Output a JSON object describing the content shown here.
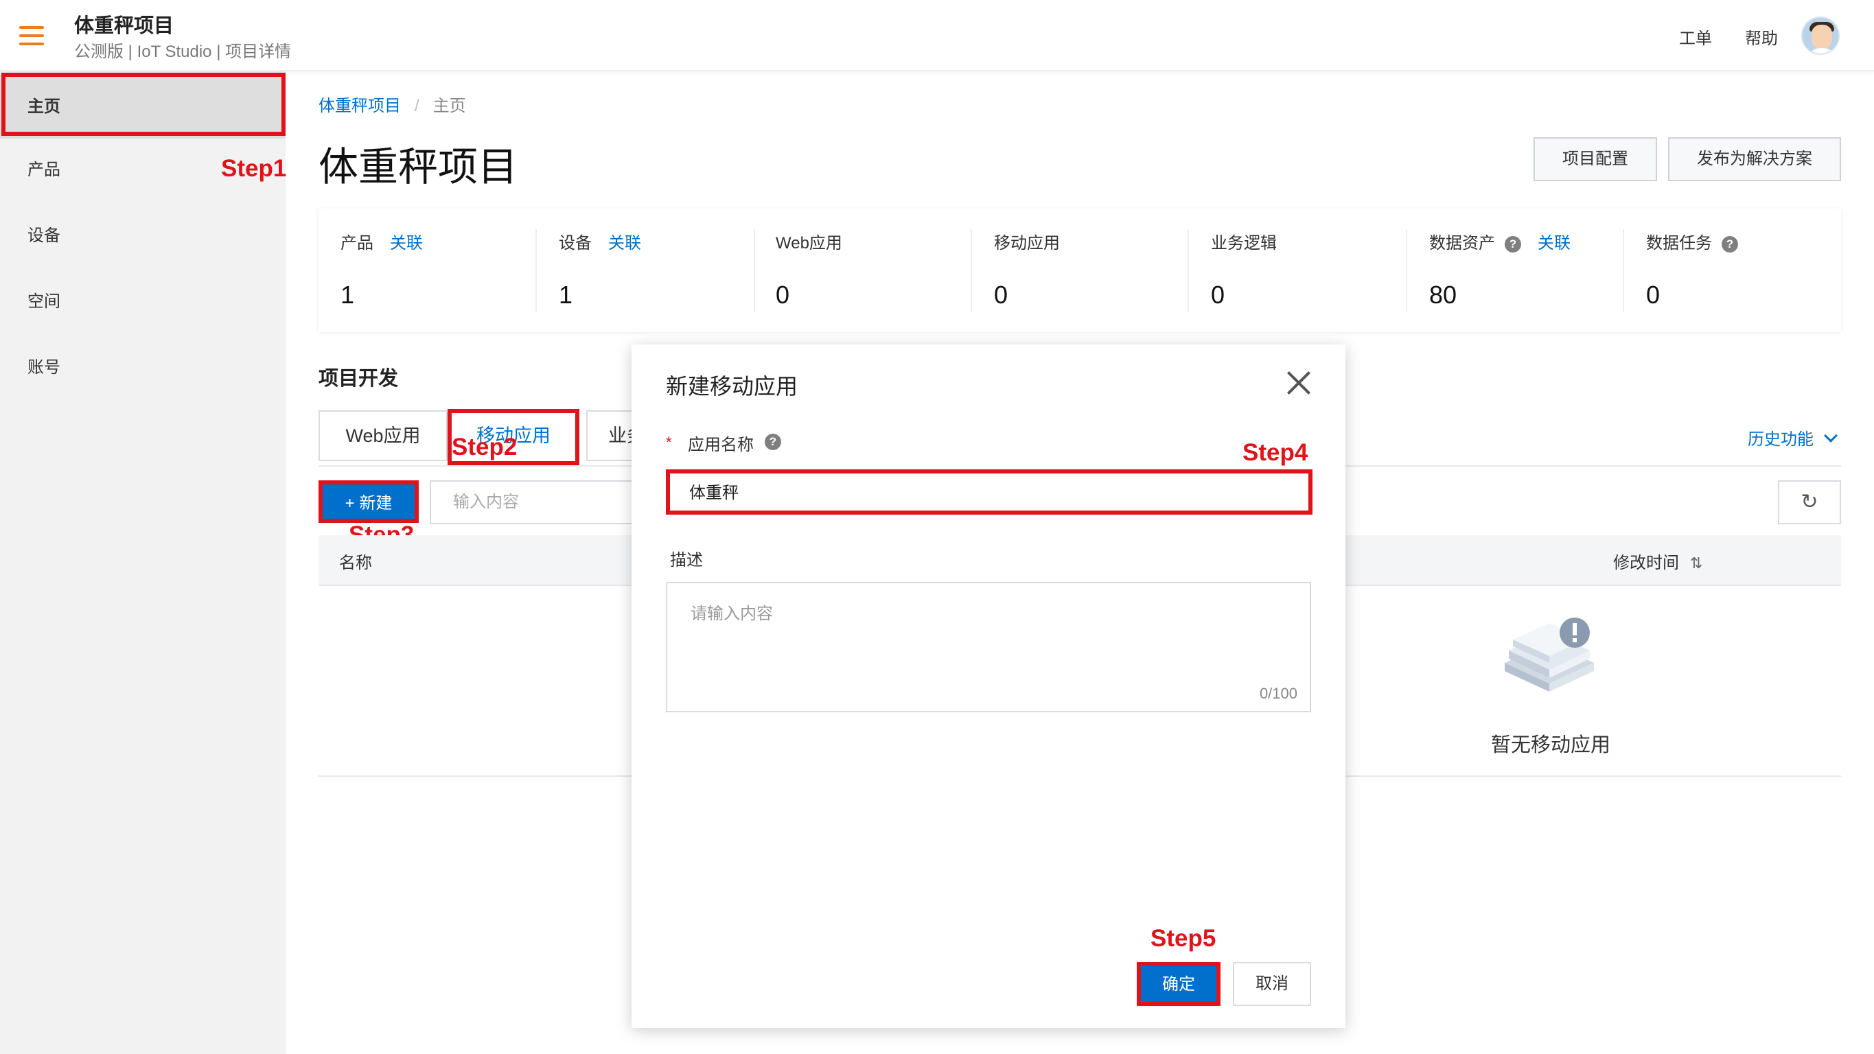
{
  "header": {
    "menu_icon": "hamburger-icon",
    "title": "体重秤项目",
    "subtitle": "公测版 | IoT Studio | 项目详情",
    "links": [
      "工单",
      "帮助"
    ],
    "avatar": "user-avatar"
  },
  "sidebar": {
    "items": [
      {
        "label": "主页",
        "active": true
      },
      {
        "label": "产品"
      },
      {
        "label": "设备"
      },
      {
        "label": "空间"
      },
      {
        "label": "账号"
      }
    ]
  },
  "breadcrumb": {
    "root": "体重秤项目",
    "separator": "/",
    "current": "主页"
  },
  "page": {
    "title": "体重秤项目",
    "buttons": {
      "config": "项目配置",
      "publish": "发布为解决方案"
    }
  },
  "stats": [
    {
      "label": "产品",
      "link": "关联",
      "value": "1"
    },
    {
      "label": "设备",
      "link": "关联",
      "value": "1"
    },
    {
      "label": "Web应用",
      "value": "0"
    },
    {
      "label": "移动应用",
      "value": "0"
    },
    {
      "label": "业务逻辑",
      "value": "0"
    },
    {
      "label": "数据资产",
      "help": "?",
      "link": "关联",
      "value": "80"
    },
    {
      "label": "数据任务",
      "help": "?",
      "value": "0"
    }
  ],
  "dev": {
    "title": "项目开发",
    "tabs": [
      "Web应用",
      "移动应用",
      "业务"
    ],
    "history": "历史功能",
    "new_button": "+ 新建",
    "search_placeholder": "输入内容",
    "refresh_icon": "refresh-icon",
    "columns": {
      "name": "名称",
      "modified": "修改时间"
    },
    "sort_glyph": "⇅",
    "empty_text": "暂无移动应用"
  },
  "modal": {
    "title": "新建移动应用",
    "required_mark": "*",
    "name_label": "应用名称",
    "help": "?",
    "name_value": "体重秤",
    "desc_label": "描述",
    "desc_placeholder": "请输入内容",
    "desc_count": "0/100",
    "ok": "确定",
    "cancel": "取消"
  },
  "annotations": {
    "color": "#e0131b",
    "steps": [
      "Step1",
      "Step2",
      "Step3",
      "Step4",
      "Step5"
    ]
  },
  "colors": {
    "accent": "#0070cc",
    "brand": "#f07b1c",
    "annotation": "#e0131b"
  }
}
